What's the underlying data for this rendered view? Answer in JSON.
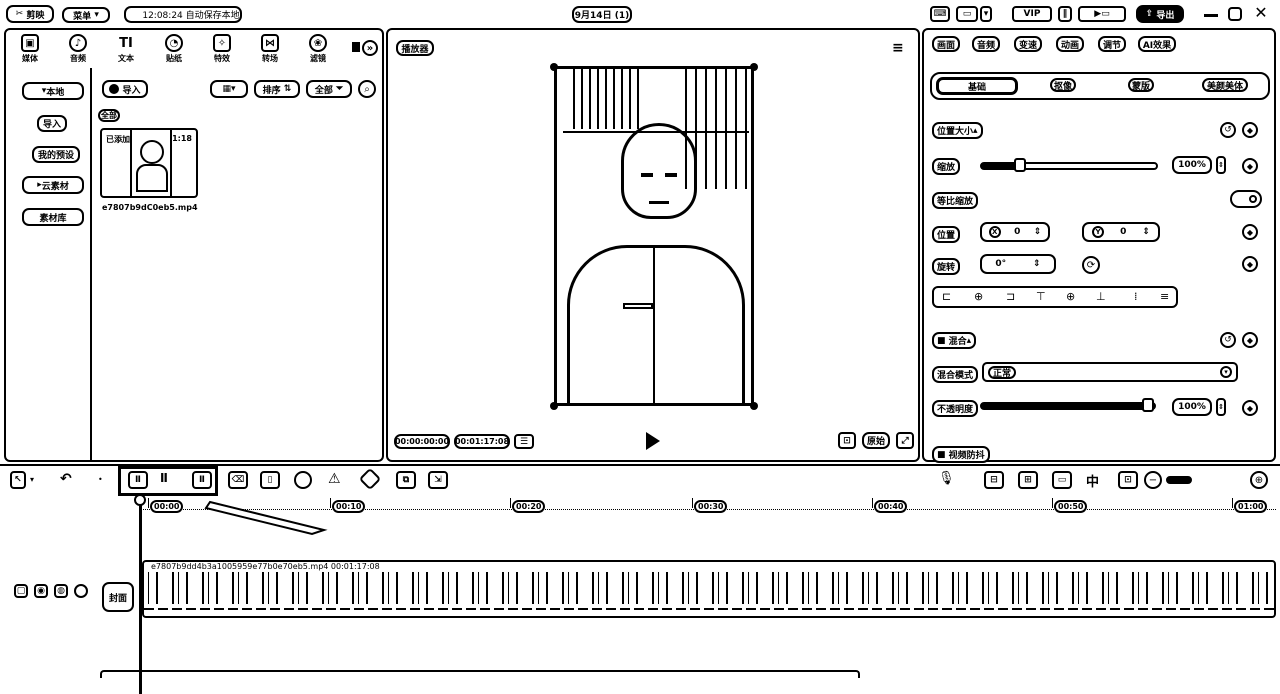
{
  "titlebar": {
    "app_name": "剪映",
    "menu_label": "菜单",
    "autosave": "12:08:24 自动保存本地",
    "project_title": "9月14日 (1)",
    "export_label": "导出"
  },
  "media_tabs": [
    {
      "label": "媒体",
      "glyph": "▣",
      "icon": "media-icon"
    },
    {
      "label": "音频",
      "glyph": "♪",
      "icon": "audio-icon"
    },
    {
      "label": "文本",
      "glyph": "TI",
      "icon": "text-icon"
    },
    {
      "label": "贴纸",
      "glyph": "◔",
      "icon": "sticker-icon"
    },
    {
      "label": "特效",
      "glyph": "✧",
      "icon": "effects-icon"
    },
    {
      "label": "转场",
      "glyph": "⋈",
      "icon": "transition-icon"
    },
    {
      "label": "滤镜",
      "glyph": "❀",
      "icon": "filter-icon"
    }
  ],
  "left_nav": {
    "local": "本地",
    "import": "导入",
    "my_presets": "我的预设",
    "cloud": "云素材",
    "library": "素材库"
  },
  "media_toolbar": {
    "import_btn": "导入",
    "sort_btn": "排序",
    "all_btn": "全部",
    "filter_all": "全部"
  },
  "media_clip": {
    "added_label": "已添加",
    "duration": "01:18",
    "filename": "e7807b9dC0eb5.mp4"
  },
  "player": {
    "title": "播放器",
    "current_time": "00:00:00:00",
    "total_time": "00:01:17:08",
    "ratio_btn": "原始"
  },
  "props": {
    "tabs": [
      "画面",
      "音频",
      "变速",
      "动画",
      "调节",
      "AI效果"
    ],
    "subtabs": [
      "基础",
      "抠像",
      "蒙版",
      "美颜美体"
    ],
    "section_pos": "位置大小",
    "scale_label": "缩放",
    "scale_value": "100%",
    "scale_fraction": 0.2,
    "uniform_label": "等比缩放",
    "position_label": "位置",
    "x_label": "X",
    "x_value": "0",
    "y_label": "Y",
    "y_value": "0",
    "rotate_label": "旋转",
    "rotate_value": "0°",
    "section_blend": "混合",
    "blend_mode_label": "混合模式",
    "blend_mode_value": "正常",
    "opacity_label": "不透明度",
    "opacity_value": "100%",
    "opacity_fraction": 1.0,
    "stabilize_label": "视频防抖"
  },
  "timeline": {
    "cover_label": "封面",
    "clip_label": "e7807b9dd4b3a1005959e77b0e70eb5.mp4  00:01:17:08",
    "ticks": [
      "00:00",
      "00:10",
      "00:20",
      "00:30",
      "00:40",
      "00:50",
      "01:00"
    ]
  },
  "colors": {
    "ink": "#000000",
    "paper": "#ffffff"
  }
}
